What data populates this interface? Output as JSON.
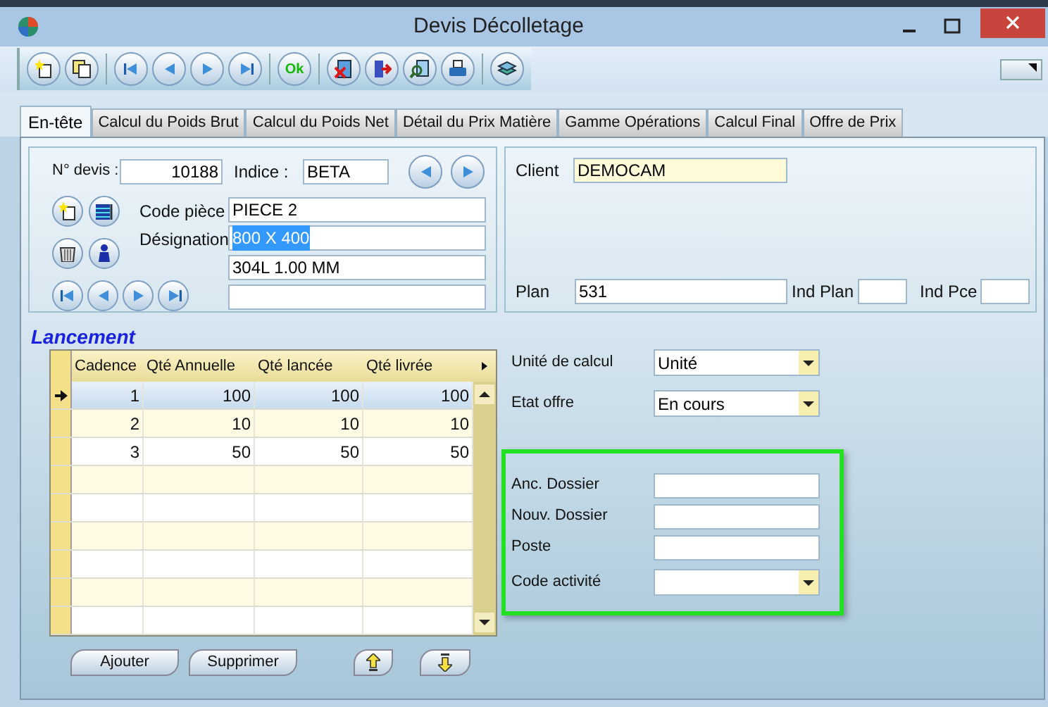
{
  "window": {
    "title": "Devis Décolletage"
  },
  "toolbar": {
    "ok_label": "Ok"
  },
  "tabs": [
    {
      "label": "En-tête",
      "selected": true
    },
    {
      "label": "Calcul du Poids Brut",
      "selected": false
    },
    {
      "label": "Calcul du Poids Net",
      "selected": false
    },
    {
      "label": "Détail du Prix Matière",
      "selected": false
    },
    {
      "label": "Gamme Opérations",
      "selected": false
    },
    {
      "label": "Calcul Final",
      "selected": false
    },
    {
      "label": "Offre de Prix",
      "selected": false
    }
  ],
  "piece": {
    "devis_label": "N° devis :",
    "devis_value": "10188",
    "indice_label": "Indice :",
    "indice_value": "BETA",
    "code_piece_label": "Code pièce",
    "code_piece_value": "PIECE 2",
    "designation_label": "Désignation",
    "designation_lines": [
      {
        "value": "800 X 400",
        "text_selected": true
      },
      {
        "value": "304L 1.00 MM",
        "text_selected": false
      }
    ]
  },
  "client": {
    "client_label": "Client",
    "client_value": "DEMOCAM",
    "plan_label": "Plan",
    "plan_value": "531",
    "ind_plan_label": "Ind Plan",
    "ind_pce_label": "Ind Pce"
  },
  "lancement": {
    "title": "Lancement",
    "columns": [
      "Cadence",
      "Qté Annuelle",
      "Qté lancée",
      "Qté livrée"
    ],
    "rows": [
      {
        "cells": [
          "1",
          "100",
          "100",
          "100"
        ],
        "selected": true
      },
      {
        "cells": [
          "2",
          "10",
          "10",
          "10"
        ],
        "selected": false
      },
      {
        "cells": [
          "3",
          "50",
          "50",
          "50"
        ],
        "selected": false
      }
    ],
    "buttons": [
      "Ajouter",
      "Supprimer"
    ]
  },
  "settings": [
    {
      "label": "Unité de calcul",
      "value": "Unité",
      "kind": "dropdown"
    },
    {
      "label": "Etat offre",
      "value": "En cours",
      "kind": "dropdown"
    }
  ],
  "dossier": [
    {
      "label": "Anc. Dossier",
      "kind": "text"
    },
    {
      "label": "Nouv. Dossier",
      "kind": "text"
    },
    {
      "label": "Poste",
      "kind": "text"
    },
    {
      "label": "Code activité",
      "kind": "dropdown"
    }
  ]
}
